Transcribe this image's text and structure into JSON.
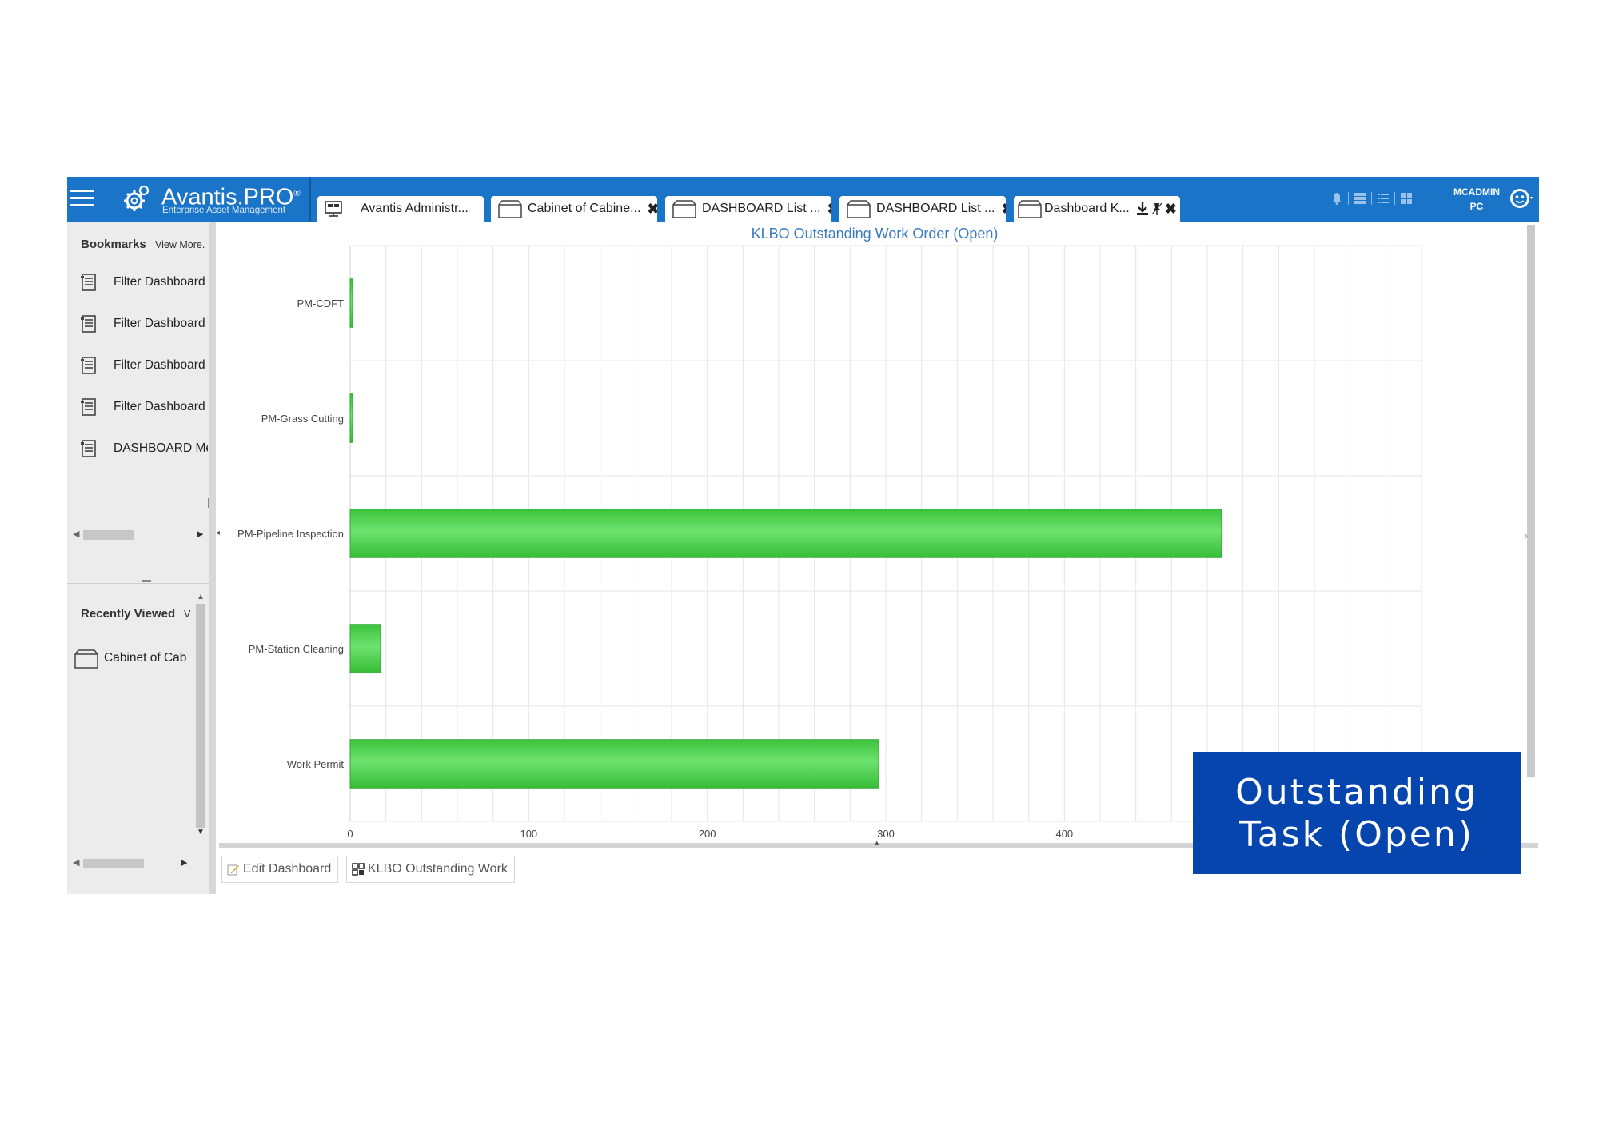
{
  "app": {
    "brand": "Avantis.PRO",
    "brand_mark": "®",
    "subtitle": "Enterprise Asset Management"
  },
  "tabs": [
    {
      "label": "Avantis Administr...",
      "icon": "monitor-icon",
      "close": ""
    },
    {
      "label": "Cabinet of Cabine...",
      "icon": "folder-icon",
      "close": "✖"
    },
    {
      "label": "DASHBOARD List ...",
      "icon": "folder-icon",
      "close": "✖"
    },
    {
      "label": "DASHBOARD List ...",
      "icon": "folder-icon",
      "close": "✖"
    },
    {
      "label": "Dashboard K...",
      "icon": "folder-icon",
      "close": "✖"
    }
  ],
  "user": {
    "name": "MCADMIN",
    "location": "PC"
  },
  "sidebar": {
    "bookmarks_header": "Bookmarks",
    "bookmarks_view_more": "View More.",
    "bookmarks": [
      {
        "label": "Filter Dashboard"
      },
      {
        "label": "Filter Dashboard"
      },
      {
        "label": "Filter Dashboard"
      },
      {
        "label": "Filter Dashboard"
      },
      {
        "label": "DASHBOARD Me"
      }
    ],
    "recent_header": "Recently Viewed",
    "recent_view_more": "V",
    "recent": [
      {
        "label": "Cabinet of Cab"
      }
    ]
  },
  "chart_data": {
    "type": "bar",
    "orientation": "horizontal",
    "title": "KLBO Outstanding Work Order (Open)",
    "categories": [
      "PM-CDFT",
      "PM-Grass Cutting",
      "PM-Pipeline Inspection",
      "PM-Station Cleaning",
      "Work Permit"
    ],
    "values": [
      1,
      1,
      488,
      17,
      296
    ],
    "xticks": [
      0,
      100,
      200,
      300,
      400
    ],
    "xlim": [
      0,
      600
    ],
    "grid": true,
    "bar_color": "#4ed24e"
  },
  "bottom_tabs": [
    {
      "label": "Edit Dashboard",
      "icon": "pencil-icon"
    },
    {
      "label": "KLBO Outstanding Work",
      "icon": "dashboard-icon"
    }
  ],
  "overlay": {
    "text": "Outstanding Task (Open)"
  }
}
